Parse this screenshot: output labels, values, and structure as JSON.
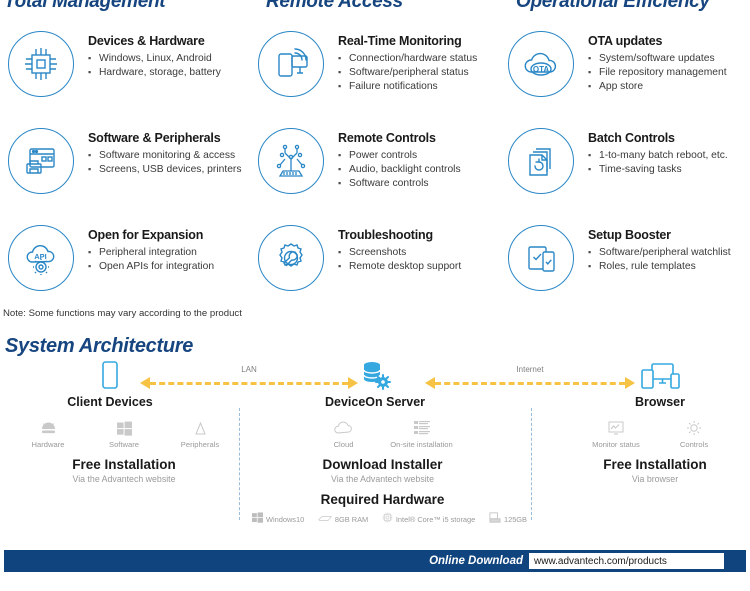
{
  "columns": [
    {
      "title": "Total Management"
    },
    {
      "title": "Remote Access"
    },
    {
      "title": "Operational Efficiency"
    }
  ],
  "features": [
    [
      {
        "icon": "cpu-chip-icon",
        "title": "Devices & Hardware",
        "bullets": [
          "Windows, Linux, Android",
          "Hardware, storage, battery"
        ]
      },
      {
        "icon": "remote-monitor-icon",
        "title": "Real-Time Monitoring",
        "bullets": [
          "Connection/hardware status",
          "Software/peripheral status",
          "Failure notifications"
        ]
      },
      {
        "icon": "cloud-ota-icon",
        "title": "OTA updates",
        "bullets": [
          "System/software updates",
          "File repository management",
          "App store"
        ]
      }
    ],
    [
      {
        "icon": "software-printer-icon",
        "title": "Software & Peripherals",
        "bullets": [
          "Software monitoring & access",
          "Screens, USB devices, printers"
        ]
      },
      {
        "icon": "circuit-controls-icon",
        "title": "Remote Controls",
        "bullets": [
          "Power controls",
          "Audio, backlight controls",
          "Software controls"
        ]
      },
      {
        "icon": "stacked-documents-icon",
        "title": "Batch Controls",
        "bullets": [
          "1-to-many batch reboot, etc.",
          "Time-saving tasks"
        ]
      }
    ],
    [
      {
        "icon": "cloud-api-gear-icon",
        "title": "Open for Expansion",
        "bullets": [
          "Peripheral integration",
          "Open APIs for integration"
        ]
      },
      {
        "icon": "gear-wrench-icon",
        "title": "Troubleshooting",
        "bullets": [
          "Screenshots",
          "Remote desktop support"
        ]
      },
      {
        "icon": "device-checklist-icon",
        "title": "Setup Booster",
        "bullets": [
          "Software/peripheral watchlist",
          "Roles, rule templates"
        ]
      }
    ]
  ],
  "note": "Note: Some functions may vary according to the product",
  "architecture": {
    "section_title": "System Architecture",
    "nodes": {
      "client": {
        "icon": "mobile-device-icon",
        "label": "Client Devices"
      },
      "server": {
        "icon": "database-gear-icon",
        "label": "DeviceOn Server"
      },
      "browser": {
        "icon": "multi-device-browser-icon",
        "label": "Browser"
      }
    },
    "links": [
      {
        "label": "LAN"
      },
      {
        "label": "Internet"
      }
    ],
    "client_sub": [
      {
        "icon": "android-icon",
        "label": "Hardware"
      },
      {
        "icon": "windows-icon",
        "label": "Software"
      },
      {
        "icon": "linux-peripheral-icon",
        "label": "Peripherals"
      }
    ],
    "server_sub": [
      {
        "icon": "cloud-icon",
        "label": "Cloud"
      },
      {
        "icon": "onsite-server-icon",
        "label": "On-site installation"
      }
    ],
    "browser_sub": [
      {
        "icon": "monitor-status-icon",
        "label": "Monitor status"
      },
      {
        "icon": "controls-gear-icon",
        "label": "Controls"
      }
    ],
    "client_block": {
      "title": "Free Installation",
      "subtitle": "Via the Advantech website"
    },
    "server_block": {
      "title": "Download Installer",
      "subtitle": "Via the Advantech website"
    },
    "browser_block": {
      "title": "Free Installation",
      "subtitle": "Via browser"
    },
    "required_hardware_title": "Required Hardware",
    "required_hardware": [
      {
        "icon": "windows-icon",
        "label": "Windows10"
      },
      {
        "icon": "ram-stick-icon",
        "label": "8GB RAM"
      },
      {
        "icon": "cpu-icon",
        "label": "Intel® Core™ i5 storage"
      },
      {
        "icon": "hdd-icon",
        "label": "125GB"
      }
    ]
  },
  "footer": {
    "download_label": "Online Download",
    "url": "www.advantech.com/products"
  },
  "colors": {
    "heading_navy": "#16457F",
    "icon_blue": "#2A87C6",
    "arrow_yellow": "#F6C344",
    "footer_navy": "#10447F",
    "muted_gray": "#9a9a9a"
  }
}
